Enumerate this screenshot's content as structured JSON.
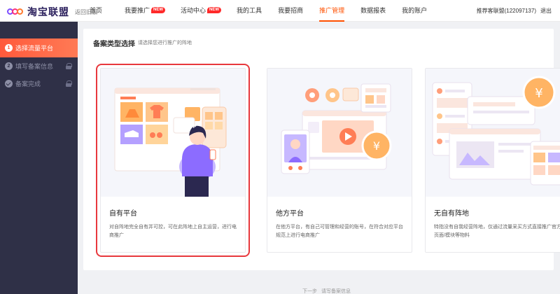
{
  "brand": {
    "name": "淘宝联盟",
    "return_old": "返回旧版"
  },
  "nav": {
    "items": [
      {
        "label": "首页",
        "new": false
      },
      {
        "label": "我要推广",
        "new": true
      },
      {
        "label": "活动中心",
        "new": true
      },
      {
        "label": "我的工具",
        "new": false
      },
      {
        "label": "我要招商",
        "new": false
      },
      {
        "label": "推广管理",
        "new": false,
        "active": true
      },
      {
        "label": "数据报表",
        "new": false
      },
      {
        "label": "我的账户",
        "new": false
      }
    ],
    "new_badge": "NEW",
    "user": "推荐客联盟(122097137)",
    "logout": "退出"
  },
  "steps": [
    {
      "num": "1",
      "label": "选择流量平台"
    },
    {
      "num": "2",
      "label": "填写备案信息"
    },
    {
      "label": "备案完成"
    }
  ],
  "panel": {
    "title": "备案类型选择",
    "subtitle": "请选择您进行推广的阵地"
  },
  "cards": [
    {
      "title": "自有平台",
      "desc": "对自阵地完全自有并可控，可在此阵地上自主运营，进行电商推广",
      "app_label": "APP"
    },
    {
      "title": "他方平台",
      "desc": "在他方平台，有自己可管理和经营的账号，在符合对应平台规范上进行电商推广"
    },
    {
      "title": "无自有阵地",
      "desc": "特指没有自我经营阵地，仅通过流量采买方式直接推广官方页面/模块等物料"
    }
  ],
  "footer": {
    "next_label": "下一步",
    "next_hint": "请写备案信息"
  },
  "colors": {
    "accent": "#ff5000",
    "sidebar": "#2f3047",
    "selected_border": "#e8383d"
  }
}
